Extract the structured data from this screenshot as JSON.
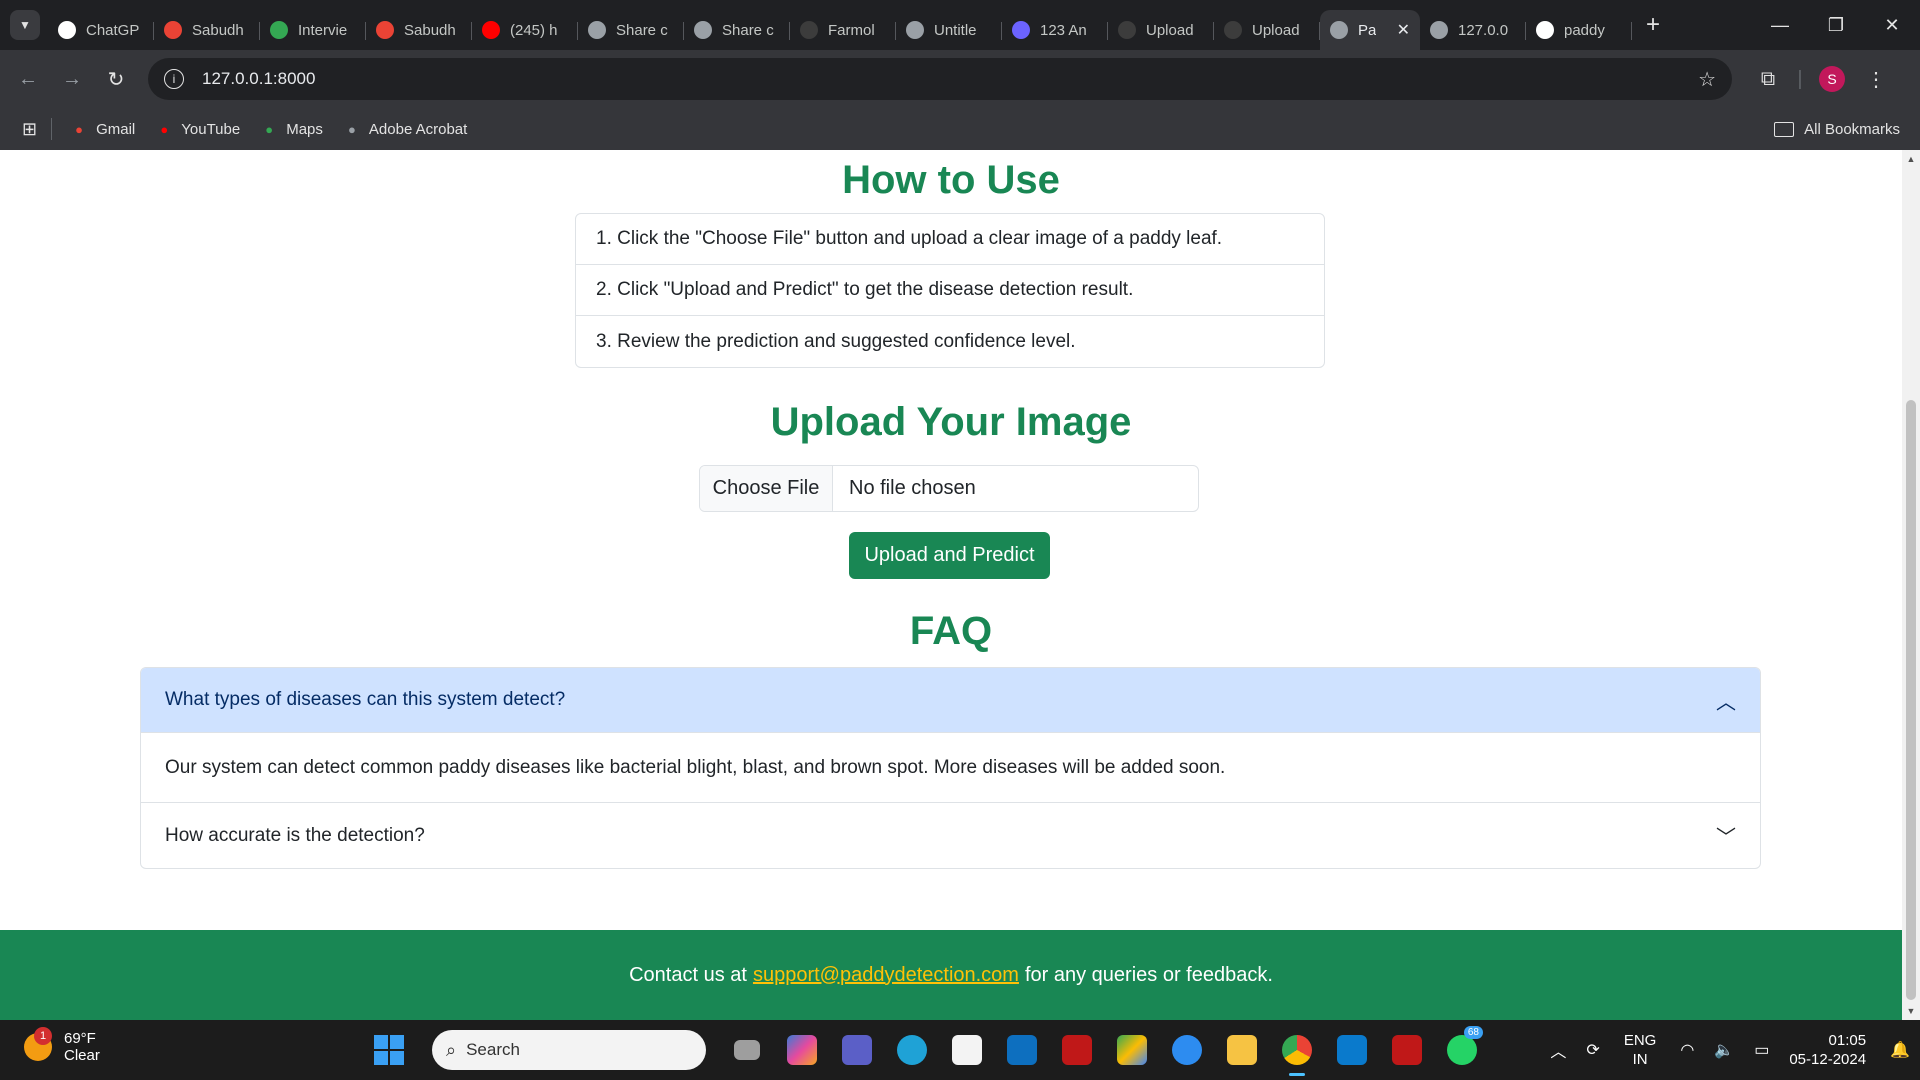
{
  "browser": {
    "tabs": [
      {
        "title": "ChatGP",
        "fav": "chatgpt-icon",
        "color": "#ffffff"
      },
      {
        "title": "Sabudh",
        "fav": "gmail-icon",
        "color": "#ea4335"
      },
      {
        "title": "Intervie",
        "fav": "drive-icon",
        "color": "#34a853"
      },
      {
        "title": "Sabudh",
        "fav": "gmail-icon",
        "color": "#ea4335"
      },
      {
        "title": "(245) h",
        "fav": "youtube-icon",
        "color": "#ff0000"
      },
      {
        "title": "Share c",
        "fav": "globe-icon",
        "color": "#9aa0a6"
      },
      {
        "title": "Share c",
        "fav": "globe-icon",
        "color": "#9aa0a6"
      },
      {
        "title": "Farmol",
        "fav": "github-icon",
        "color": "#3c3c3c"
      },
      {
        "title": "Untitle",
        "fav": "globe-icon",
        "color": "#9aa0a6"
      },
      {
        "title": "123 An",
        "fav": "app-icon",
        "color": "#6c63ff"
      },
      {
        "title": "Upload",
        "fav": "github-icon",
        "color": "#3c3c3c"
      },
      {
        "title": "Upload",
        "fav": "github-icon",
        "color": "#3c3c3c"
      },
      {
        "title": "Pa",
        "fav": "globe-icon",
        "color": "#9aa0a6",
        "active": true
      },
      {
        "title": "127.0.0",
        "fav": "globe-icon",
        "color": "#9aa0a6"
      },
      {
        "title": "paddy",
        "fav": "google-icon",
        "color": "#ffffff"
      }
    ],
    "url": "127.0.0.1:8000",
    "profile_initial": "S",
    "bookmarks": [
      {
        "label": "Gmail",
        "icon": "gmail-icon",
        "color": "#ea4335"
      },
      {
        "label": "YouTube",
        "icon": "youtube-icon",
        "color": "#ff0000"
      },
      {
        "label": "Maps",
        "icon": "maps-icon",
        "color": "#34a853"
      },
      {
        "label": "Adobe Acrobat",
        "icon": "globe-icon",
        "color": "#9aa0a6"
      }
    ],
    "all_bookmarks": "All Bookmarks"
  },
  "page": {
    "howto_title": "How to Use",
    "steps": [
      "1. Click the \"Choose File\" button and upload a clear image of a paddy leaf.",
      "2. Click \"Upload and Predict\" to get the disease detection result.",
      "3. Review the prediction and suggested confidence level."
    ],
    "upload_title": "Upload Your Image",
    "choose_file": "Choose File",
    "no_file": "No file chosen",
    "upload_button": "Upload and Predict",
    "faq_title": "FAQ",
    "faq": [
      {
        "q": "What types of diseases can this system detect?",
        "a": "Our system can detect common paddy diseases like bacterial blight, blast, and brown spot. More diseases will be added soon."
      },
      {
        "q": "How accurate is the detection?"
      }
    ],
    "footer": {
      "before": "Contact us at",
      "email": "support@paddydetection.com",
      "after": "for any queries or feedback."
    },
    "accent": "#198754"
  },
  "taskbar": {
    "temp": "69°F",
    "weather": "Clear",
    "weather_badge": "1",
    "search": "Search",
    "whatsapp_count": "68",
    "lang1": "ENG",
    "lang2": "IN",
    "time": "01:05",
    "date": "05-12-2024"
  }
}
